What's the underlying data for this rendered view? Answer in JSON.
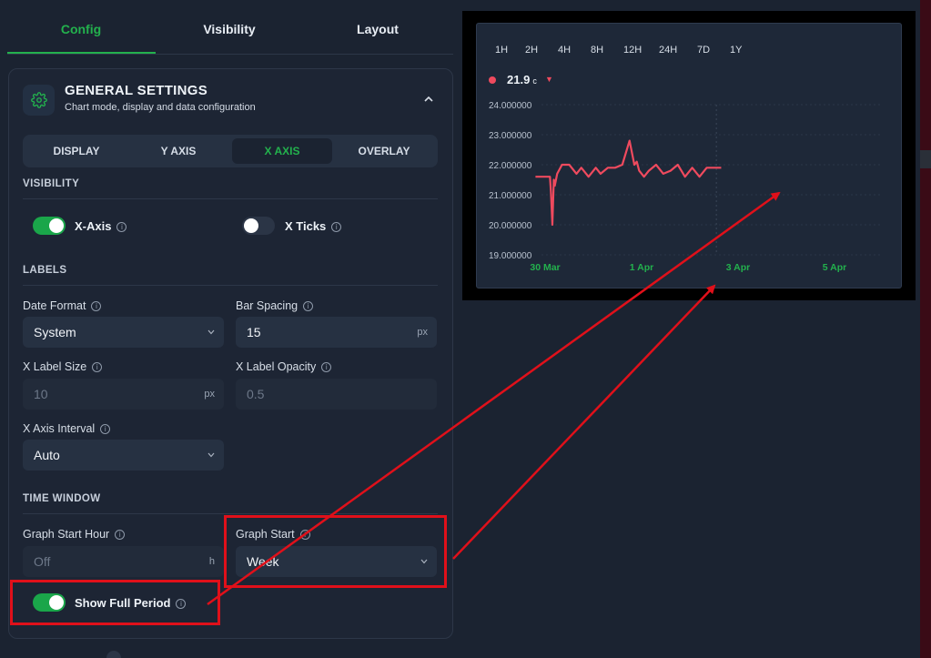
{
  "top_tabs": [
    {
      "label": "Config",
      "active": true
    },
    {
      "label": "Visibility",
      "active": false
    },
    {
      "label": "Layout",
      "active": false
    }
  ],
  "general_settings": {
    "title": "GENERAL SETTINGS",
    "subtitle": "Chart mode, display and data configuration",
    "icon": "gear-icon",
    "collapse_icon": "chevron-up-icon"
  },
  "sub_tabs": [
    {
      "label": "DISPLAY",
      "active": false
    },
    {
      "label": "Y AXIS",
      "active": false
    },
    {
      "label": "X AXIS",
      "active": true
    },
    {
      "label": "OVERLAY",
      "active": false
    }
  ],
  "visibility": {
    "section_title": "VISIBILITY",
    "x_axis": {
      "label": "X-Axis",
      "on": true
    },
    "x_ticks": {
      "label": "X Ticks",
      "on": false
    }
  },
  "labels": {
    "section_title": "LABELS",
    "date_format": {
      "label": "Date Format",
      "value": "System"
    },
    "bar_spacing": {
      "label": "Bar Spacing",
      "value": "15",
      "unit": "px"
    },
    "x_label_size": {
      "label": "X Label Size",
      "placeholder": "10",
      "unit": "px"
    },
    "x_label_opacity": {
      "label": "X Label Opacity",
      "placeholder": "0.5"
    },
    "x_axis_interval": {
      "label": "X Axis Interval",
      "value": "Auto"
    }
  },
  "time_window": {
    "section_title": "TIME WINDOW",
    "graph_start_hour": {
      "label": "Graph Start Hour",
      "placeholder": "Off",
      "unit": "h"
    },
    "graph_start": {
      "label": "Graph Start",
      "value": "Week"
    },
    "show_full_period": {
      "label": "Show Full Period",
      "on": true
    }
  },
  "chart_preview": {
    "ranges": [
      "1H",
      "2H",
      "4H",
      "8H",
      "12H",
      "24H",
      "7D",
      "1Y"
    ],
    "legend": {
      "value": "21.9",
      "unit": "c",
      "trend_icon": "triangle-down-icon",
      "color": "#ef4a5e"
    }
  },
  "chart_data": {
    "type": "line",
    "title": "",
    "xlabel": "",
    "ylabel": "",
    "ylim": [
      19,
      24
    ],
    "yticks": [
      "24.000000",
      "23.000000",
      "22.000000",
      "21.000000",
      "20.000000",
      "19.000000"
    ],
    "xticks": [
      {
        "label": "30 Mar",
        "x": 0
      },
      {
        "label": "1 Apr",
        "x": 2
      },
      {
        "label": "3 Apr",
        "x": 4
      },
      {
        "label": "5 Apr",
        "x": 6
      }
    ],
    "grid": true,
    "series": [
      {
        "color": "#ef4a5e",
        "x": [
          -0.2,
          0.1,
          0.12,
          0.15,
          0.18,
          0.2,
          0.25,
          0.35,
          0.5,
          0.65,
          0.75,
          0.9,
          1.05,
          1.15,
          1.3,
          1.45,
          1.6,
          1.75,
          1.85,
          1.9,
          1.95,
          2.05,
          2.15,
          2.3,
          2.45,
          2.6,
          2.75,
          2.9,
          3.05,
          3.2,
          3.35,
          3.5,
          3.65
        ],
        "y": [
          21.6,
          21.6,
          21.1,
          20.0,
          21.5,
          21.3,
          21.7,
          22.0,
          22.0,
          21.7,
          21.9,
          21.6,
          21.9,
          21.7,
          21.9,
          21.9,
          22.0,
          22.8,
          22.0,
          22.1,
          21.8,
          21.6,
          21.8,
          22.0,
          21.7,
          21.8,
          22.0,
          21.6,
          21.9,
          21.6,
          21.9,
          21.9,
          21.9
        ]
      }
    ]
  },
  "colors": {
    "accent": "#23b14d",
    "background": "#1b2331",
    "highlight": "#e0101a",
    "series": "#ef4a5e"
  }
}
